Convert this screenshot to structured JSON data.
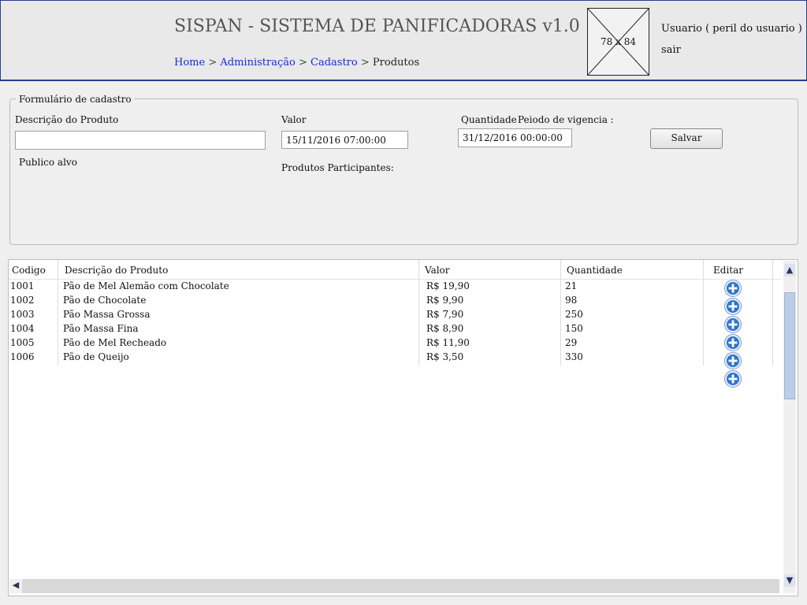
{
  "header": {
    "title": "SISPAN - SISTEMA DE PANIFICADORAS v1.0",
    "breadcrumb": {
      "home": "Home",
      "sep": ">",
      "admin": "Administração",
      "cadastro": "Cadastro",
      "current": "Produtos"
    },
    "image_placeholder": "78 x 84",
    "user": "Usuario ( peril do usuario )",
    "logout": "sair"
  },
  "form": {
    "legend": "Formulário de cadastro",
    "descricao_label": "Descrição do Produto",
    "descricao_value": "",
    "valor_label": "Valor",
    "valor_value": "15/11/2016 07:00:00",
    "quantidade_label": "Quantidade",
    "periodo_label": "Peiodo de vigencia :",
    "periodo_value": "31/12/2016 00:00:00",
    "publico_label": "Publico alvo",
    "participantes_label": "Produtos Participantes:",
    "save_label": "Salvar"
  },
  "table": {
    "columns": [
      "Codigo",
      "Descrição do Produto",
      "Valor",
      "Quantidade",
      "Editar"
    ],
    "rows": [
      [
        "1001",
        "Pão de Mel Alemão com Chocolate",
        "R$ 19,90",
        "21"
      ],
      [
        "1002",
        "Pão de Chocolate",
        "R$ 9,90",
        "98"
      ],
      [
        "1003",
        "Pão Massa Grossa",
        "R$ 7,90",
        "250"
      ],
      [
        "1004",
        "Pão Massa Fina",
        "R$ 8,90",
        "150"
      ],
      [
        "1005",
        "Pão de Mel Recheado",
        "R$ 11,90",
        "29"
      ],
      [
        "1006",
        "Pão de Queijo",
        "R$ 3,50",
        "330"
      ]
    ],
    "edit_icon": "plus-circle-icon",
    "edit_icon_count": 6
  },
  "colors": {
    "header_border": "#2a3d8f",
    "link": "#1a2bd4",
    "edit_icon": "#2f74d0"
  }
}
